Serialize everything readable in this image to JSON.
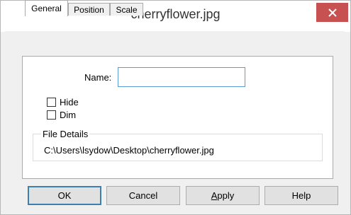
{
  "window": {
    "title": "cherryflower.jpg"
  },
  "tabs": [
    {
      "label": "General",
      "active": true
    },
    {
      "label": "Position",
      "active": false
    },
    {
      "label": "Scale",
      "active": false
    }
  ],
  "general": {
    "name_label": "Name:",
    "name_value": "",
    "hide_label": "Hide",
    "hide_checked": false,
    "dim_label": "Dim",
    "dim_checked": false,
    "file_details_title": "File Details",
    "file_path": "C:\\Users\\lsydow\\Desktop\\cherryflower.jpg"
  },
  "buttons": {
    "ok": "OK",
    "cancel": "Cancel",
    "apply_mnemonic": "A",
    "apply_rest": "pply",
    "help": "Help"
  },
  "colors": {
    "close_button": "#c75050",
    "input_focus_border": "#5b9bd5",
    "default_button_border": "#3c7fb1"
  }
}
